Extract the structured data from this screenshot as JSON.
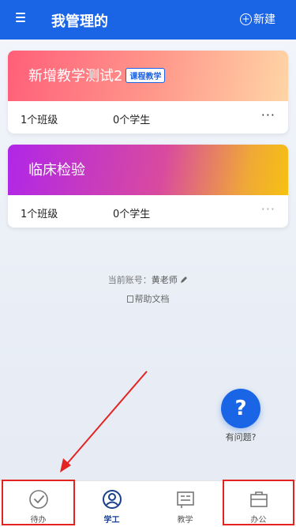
{
  "header": {
    "title": "我管理的",
    "new_label": "新建"
  },
  "courses": [
    {
      "title": "新增教学测试2",
      "badge": "课程教学",
      "classes": "1个班级",
      "students": "0个学生"
    },
    {
      "title": "临床检验",
      "classes": "1个班级",
      "students": "0个学生"
    }
  ],
  "account": {
    "label": "当前账号：",
    "name": "黄老师"
  },
  "help": {
    "label": "帮助文档"
  },
  "qa": {
    "icon": "question-icon",
    "label": "有问题?"
  },
  "tabs": [
    {
      "label": "待办",
      "icon": "check-circle-icon"
    },
    {
      "label": "学工",
      "icon": "user-circle-icon"
    },
    {
      "label": "教学",
      "icon": "teaching-board-icon"
    },
    {
      "label": "办公",
      "icon": "briefcase-icon"
    }
  ],
  "colors": {
    "primary": "#1a64e6",
    "annotation": "#e32222"
  }
}
